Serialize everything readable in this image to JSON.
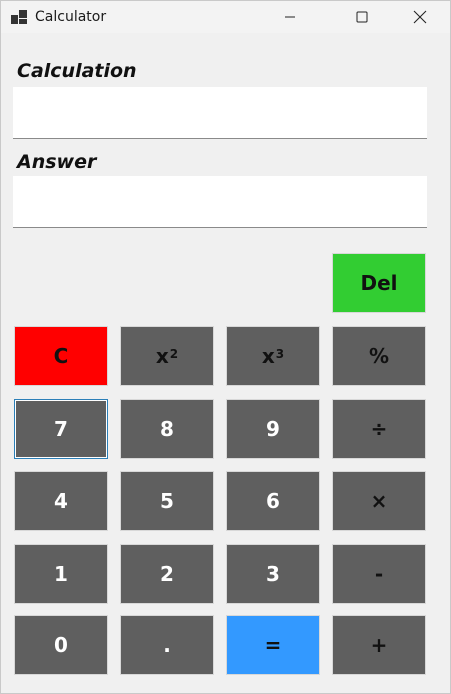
{
  "window": {
    "title": "Calculator",
    "app_icon": "calculator-app-icon",
    "controls": [
      "minimize-icon",
      "maximize-icon",
      "close-icon"
    ]
  },
  "calculation": {
    "label": "Calculation",
    "value": ""
  },
  "answer": {
    "label": "Answer",
    "value": ""
  },
  "keys": {
    "del": "Del",
    "clear": "C",
    "square": {
      "base": "x",
      "exp": "2"
    },
    "cube": {
      "base": "x",
      "exp": "3"
    },
    "percent": "%",
    "seven": "7",
    "eight": "8",
    "nine": "9",
    "divide": "÷",
    "four": "4",
    "five": "5",
    "six": "6",
    "multiply": "×",
    "one": "1",
    "two": "2",
    "three": "3",
    "subtract": "-",
    "zero": "0",
    "decimal": ".",
    "equals": "=",
    "add": "+"
  },
  "colors": {
    "key_gray": "#5f5f5f",
    "clear_red": "#ff0000",
    "del_green": "#32cd32",
    "equals_blue": "#3399ff"
  }
}
